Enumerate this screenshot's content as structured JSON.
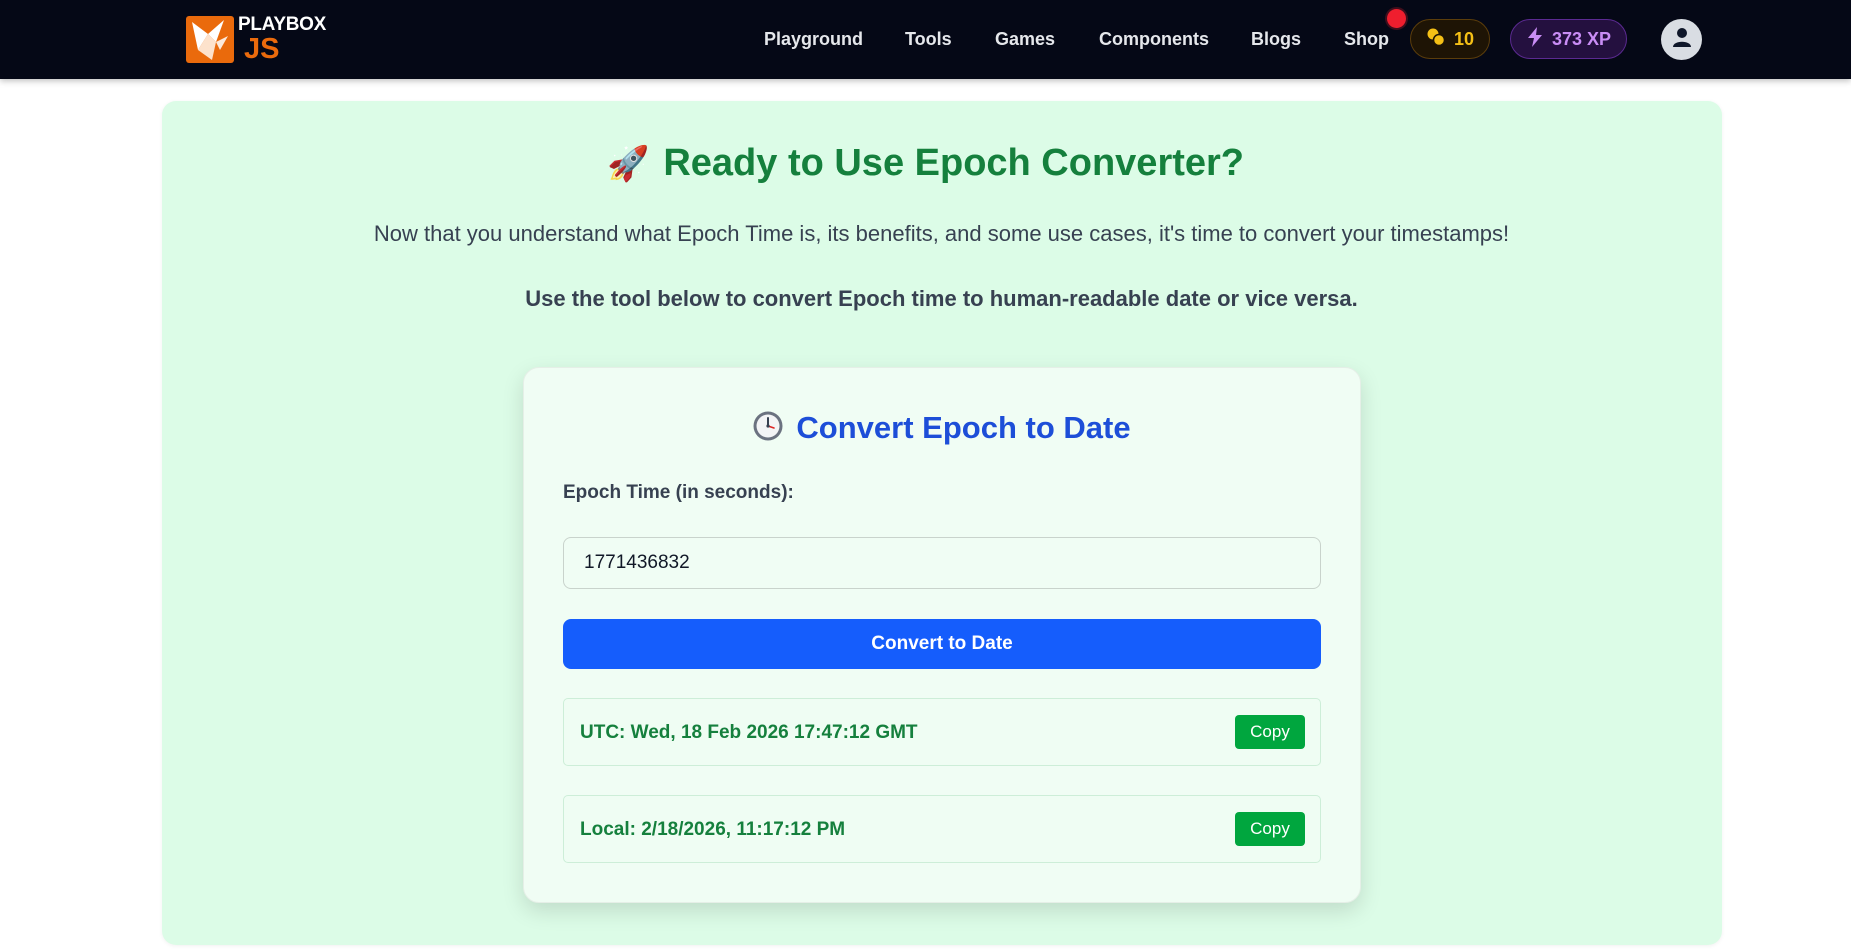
{
  "header": {
    "logo_line1": "PLAYBOX",
    "logo_line2": "JS",
    "nav": [
      "Playground",
      "Tools",
      "Games",
      "Components",
      "Blogs",
      "Shop"
    ],
    "coins": "10",
    "xp": "373 XP"
  },
  "hero": {
    "emoji": "🚀",
    "title": "Ready to Use Epoch Converter?",
    "description": "Now that you understand what Epoch Time is, its benefits, and some use cases, it's time to convert your timestamps!",
    "subtitle": "Use the tool below to convert Epoch time to human-readable date or vice versa."
  },
  "converter": {
    "title": "Convert Epoch to Date",
    "input_label": "Epoch Time (in seconds):",
    "input_value": "1771436832",
    "button_label": "Convert to Date",
    "utc_result": "UTC: Wed, 18 Feb 2026 17:47:12 GMT",
    "local_result": "Local: 2/18/2026, 11:17:12 PM",
    "copy_label": "Copy"
  },
  "colors": {
    "nav_bg": "#050816",
    "brand_orange": "#ea6a0c",
    "hero_bg": "#dcfce7",
    "title_green": "#15803d",
    "title_blue": "#1d4ed8",
    "primary_button": "#155dfc",
    "copy_button": "#00a63e",
    "coin_color": "#f5c016",
    "xp_color": "#c98df5"
  },
  "icons": {
    "logo": "origami-bird-icon",
    "coin": "coins-icon",
    "xp": "lightning-bolt-icon",
    "avatar": "user-icon",
    "converter": "clock-icon"
  }
}
